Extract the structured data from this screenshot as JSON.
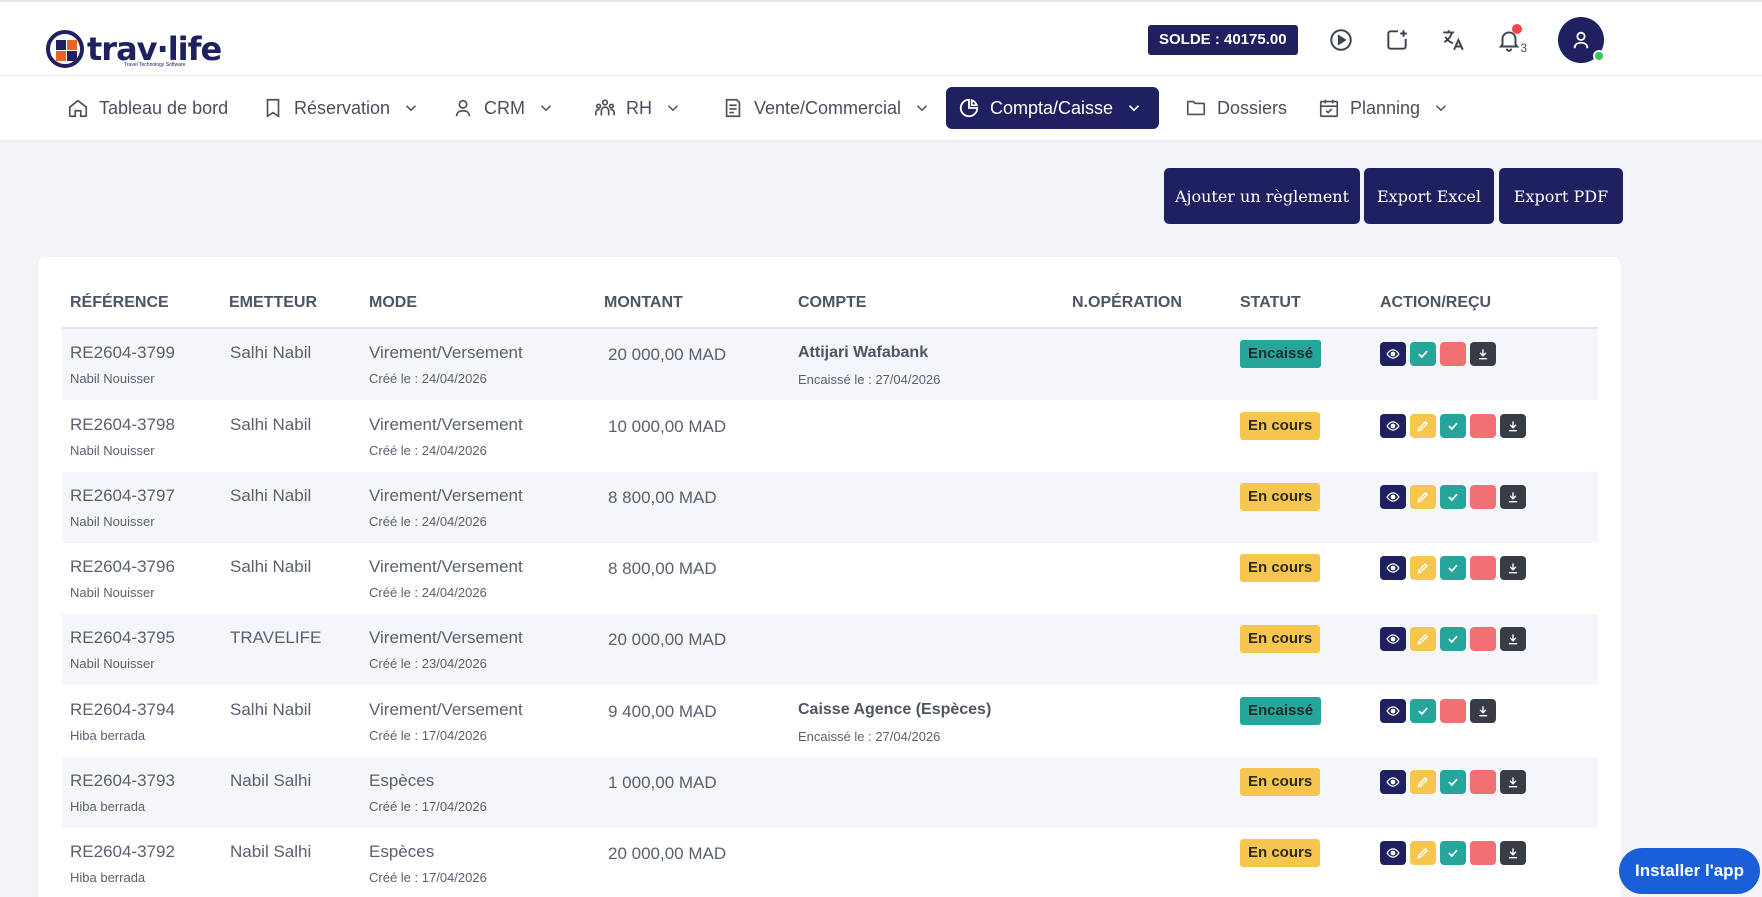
{
  "header": {
    "logo_text": "trav∙life",
    "logo_sub": "Travel Technology Software",
    "solde": "SOLDE : 40175.00",
    "notif_count": "3"
  },
  "nav": [
    {
      "label": "Tableau de bord",
      "icon": "home-icon",
      "dropdown": false
    },
    {
      "label": "Réservation",
      "icon": "bookmark-icon",
      "dropdown": true
    },
    {
      "label": "CRM",
      "icon": "user-icon",
      "dropdown": true
    },
    {
      "label": "RH",
      "icon": "users-icon",
      "dropdown": true
    },
    {
      "label": "Vente/Commercial",
      "icon": "document-icon",
      "dropdown": true
    },
    {
      "label": "Compta/Caisse",
      "icon": "pie-chart-icon",
      "dropdown": true,
      "active": true
    },
    {
      "label": "Dossiers",
      "icon": "folder-icon",
      "dropdown": false
    },
    {
      "label": "Planning",
      "icon": "calendar-icon",
      "dropdown": true
    }
  ],
  "buttons": {
    "add": "Ajouter un règlement",
    "excel": "Export Excel",
    "pdf": "Export PDF"
  },
  "table": {
    "headers": {
      "reference": "RÉFÉRENCE",
      "emetteur": "EMETTEUR",
      "mode": "MODE",
      "montant": "MONTANT",
      "compte": "COMPTE",
      "operation": "N.OPÉRATION",
      "statut": "STATUT",
      "action": "ACTION/REÇU"
    },
    "rows": [
      {
        "ref": "RE2604-3799",
        "user": "Nabil Nouisser",
        "emetteur": "Salhi Nabil",
        "mode": "Virement/Versement",
        "created": "Créé le : 24/04/2026",
        "montant": "20 000,00 MAD",
        "compte": "Attijari Wafabank",
        "encaisse": "Encaissé le : 27/04/2026",
        "statut": "Encaissé"
      },
      {
        "ref": "RE2604-3798",
        "user": "Nabil Nouisser",
        "emetteur": "Salhi Nabil",
        "mode": "Virement/Versement",
        "created": "Créé le : 24/04/2026",
        "montant": "10 000,00 MAD",
        "compte": "",
        "encaisse": "",
        "statut": "En cours"
      },
      {
        "ref": "RE2604-3797",
        "user": "Nabil Nouisser",
        "emetteur": "Salhi Nabil",
        "mode": "Virement/Versement",
        "created": "Créé le : 24/04/2026",
        "montant": "8 800,00 MAD",
        "compte": "",
        "encaisse": "",
        "statut": "En cours"
      },
      {
        "ref": "RE2604-3796",
        "user": "Nabil Nouisser",
        "emetteur": "Salhi Nabil",
        "mode": "Virement/Versement",
        "created": "Créé le : 24/04/2026",
        "montant": "8 800,00 MAD",
        "compte": "",
        "encaisse": "",
        "statut": "En cours"
      },
      {
        "ref": "RE2604-3795",
        "user": "Nabil Nouisser",
        "emetteur": "TRAVELIFE",
        "mode": "Virement/Versement",
        "created": "Créé le : 23/04/2026",
        "montant": "20 000,00 MAD",
        "compte": "",
        "encaisse": "",
        "statut": "En cours"
      },
      {
        "ref": "RE2604-3794",
        "user": "Hiba berrada",
        "emetteur": "Salhi Nabil",
        "mode": "Virement/Versement",
        "created": "Créé le : 17/04/2026",
        "montant": "9 400,00 MAD",
        "compte": "Caisse Agence (Espèces)",
        "encaisse": "Encaissé le : 27/04/2026",
        "statut": "Encaissé"
      },
      {
        "ref": "RE2604-3793",
        "user": "Hiba berrada",
        "emetteur": "Nabil Salhi",
        "mode": "Espèces",
        "created": "Créé le : 17/04/2026",
        "montant": "1 000,00 MAD",
        "compte": "",
        "encaisse": "",
        "statut": "En cours"
      },
      {
        "ref": "RE2604-3792",
        "user": "Hiba berrada",
        "emetteur": "Nabil Salhi",
        "mode": "Espèces",
        "created": "Créé le : 17/04/2026",
        "montant": "20 000,00 MAD",
        "compte": "",
        "encaisse": "",
        "statut": "En cours"
      }
    ]
  },
  "install": "Installer l'app",
  "colors": {
    "primary": "#1e2060",
    "encaisse": "#26a69a",
    "encours": "#f6c64e",
    "delete": "#f07074",
    "install": "#1b5fd8"
  }
}
